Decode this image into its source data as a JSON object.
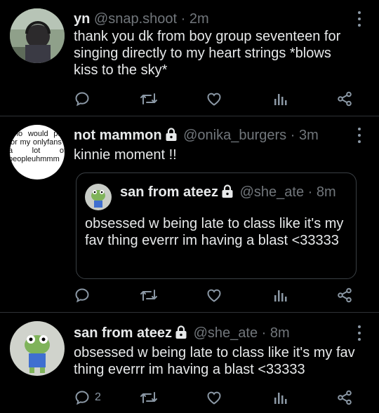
{
  "tweets": [
    {
      "name": "yn",
      "handle": "@snap.shoot",
      "sep": "·",
      "time": "2m",
      "text": "thank you dk from boy group seventeen for singing directly to my heart strings *blows kiss to the sky*"
    },
    {
      "name": "not mammon",
      "handle": "@onika_burgers",
      "sep": "·",
      "time": "3m",
      "text": "kinnie moment !!",
      "avatar_text": "who would pay for my onlyfans? a lot of peopleuhmmm",
      "quote": {
        "name": "san from ateez",
        "handle": "@she_ate",
        "sep": "·",
        "time": "8m",
        "text": "obsessed w being late to class like it's my fav thing everrr im having a blast <33333"
      }
    },
    {
      "name": "san from ateez",
      "handle": "@she_ate",
      "sep": "·",
      "time": "8m",
      "text": "obsessed w being late to class like it's my fav thing everrr im having a blast <33333",
      "reply_count": "2"
    }
  ],
  "icons": {
    "reply": "reply-icon",
    "retweet": "retweet-icon",
    "like": "heart-icon",
    "stats": "analytics-icon",
    "share": "share-icon",
    "more": "more-vertical-icon",
    "lock": "lock-icon"
  },
  "colors": {
    "background": "#000000",
    "text": "#e7e9ea",
    "muted": "#71767b",
    "icon": "#8b98a5",
    "divider": "#2f3336"
  }
}
